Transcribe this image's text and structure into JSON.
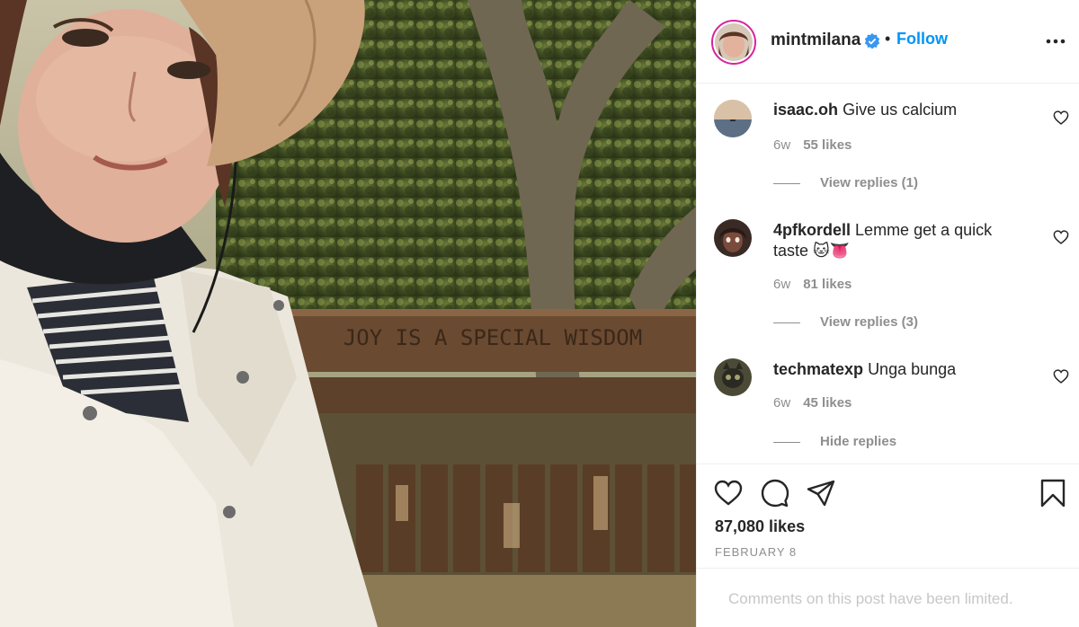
{
  "post": {
    "photo_alt_text": "JOY IS A SPECIAL WISDOM"
  },
  "header": {
    "username": "mintmilana",
    "separator": "•",
    "follow_label": "Follow"
  },
  "comments": [
    {
      "username": "isaac.oh",
      "text": "Give us calcium",
      "age": "6w",
      "likes": "55 likes",
      "replies_label": "View replies (1)"
    },
    {
      "username": "4pfkordell",
      "text": "Lemme get a quick taste 🐱👅",
      "age": "6w",
      "likes": "81 likes",
      "replies_label": "View replies (3)"
    },
    {
      "username": "techmatexp",
      "text": "Unga bunga",
      "age": "6w",
      "likes": "45 likes",
      "replies_label": "Hide replies"
    }
  ],
  "actions": {
    "likes_count": "87,080 likes",
    "date": "FEBRUARY 8"
  },
  "footer": {
    "limited_message": "Comments on this post have been limited."
  },
  "colors": {
    "link_blue": "#0095f6",
    "text_dark": "#262626",
    "text_muted": "#8e8e8e",
    "divider": "#efefef"
  },
  "icons": [
    "verified-badge-icon",
    "more-options-icon",
    "heart-icon",
    "comment-icon",
    "share-icon",
    "bookmark-icon"
  ]
}
